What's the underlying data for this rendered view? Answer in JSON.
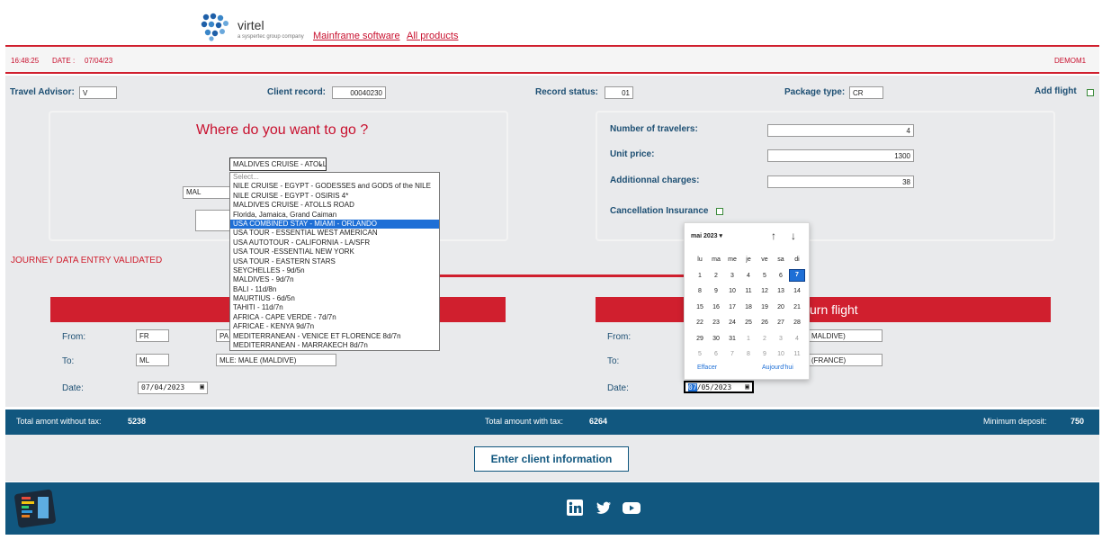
{
  "header": {
    "logo_text": "virtel",
    "logo_sub": "a syspertec group company",
    "links": [
      "Mainframe software",
      "All products"
    ]
  },
  "info": {
    "time": "16:48:25",
    "date_label": "DATE :",
    "date": "07/04/23",
    "user": "DEMOM1"
  },
  "form": {
    "travel_advisor_label": "Travel Advisor:",
    "travel_advisor": "V",
    "client_record_label": "Client record:",
    "client_record": "00040230",
    "record_status_label": "Record status:",
    "record_status": "01",
    "package_type_label": "Package type:",
    "package_type": "CR",
    "add_flight_label": "Add flight"
  },
  "destination": {
    "question": "Where do you want to go ?",
    "selected": "MALDIVES CRUISE - ATOLLS ROAD",
    "partial_field": "MAL",
    "options": [
      "Select...",
      "NILE CRUISE - EGYPT - GODESSES and GODS of the NILE",
      "NILE CRUISE - EGYPT - OSIRIS 4*",
      "MALDIVES CRUISE - ATOLLS ROAD",
      "Florida, Jamaica, Grand Caiman",
      "USA COMBINED STAY - MIAMI - ORLANDO",
      "USA TOUR - ESSENTIAL WEST AMERICAN",
      "USA AUTOTOUR - CALIFORNIA - LA/SFR",
      "USA TOUR -ESSENTIAL NEW YORK",
      "USA TOUR - EASTERN STARS",
      "SEYCHELLES - 9d/5n",
      "MALDIVES - 9d/7n",
      "BALI - 11d/8n",
      "MAURTIUS - 6d/5n",
      "TAHITI - 11d/7n",
      "AFRICA - CAPE VERDE - 7d/7n",
      "AFRICAE - KENYA 9d/7n",
      "MEDITERRANEAN - VENICE ET FLORENCE 8d/7n",
      "MEDITERRANEAN - MARRAKECH 8d/7n"
    ],
    "highlighted_index": 5
  },
  "pricing": {
    "travelers_label": "Number of travelers:",
    "travelers": "4",
    "unit_price_label": "Unit price:",
    "unit_price": "1300",
    "charges_label": "Additionnal charges:",
    "charges": "38",
    "cancellation_label": "Cancellation Insurance"
  },
  "status_message": "JOURNEY DATA ENTRY VALIDATED",
  "outbound": {
    "from_label": "From:",
    "from_code": "FR",
    "from_name": "PA",
    "to_label": "To:",
    "to_code": "ML",
    "to_name": "MLE: MALE (MALDIVE)",
    "date_label": "Date:",
    "date": "07/04/2023"
  },
  "return_flight": {
    "title_partial": "urn flight",
    "from_label": "From:",
    "from_name": "MALDIVE)",
    "to_label": "To:",
    "to_name": "(FRANCE)",
    "date_label": "Date:",
    "date_day": "07",
    "date_rest": "/05/2023"
  },
  "calendar": {
    "month": "mai 2023 ▾",
    "weekdays": [
      "lu",
      "ma",
      "me",
      "je",
      "ve",
      "sa",
      "di"
    ],
    "weeks": [
      [
        "1",
        "2",
        "3",
        "4",
        "5",
        "6",
        "7"
      ],
      [
        "8",
        "9",
        "10",
        "11",
        "12",
        "13",
        "14"
      ],
      [
        "15",
        "16",
        "17",
        "18",
        "19",
        "20",
        "21"
      ],
      [
        "22",
        "23",
        "24",
        "25",
        "26",
        "27",
        "28"
      ],
      [
        "29",
        "30",
        "31",
        "1",
        "2",
        "3",
        "4"
      ],
      [
        "5",
        "6",
        "7",
        "8",
        "9",
        "10",
        "11"
      ]
    ],
    "selected_day": "7",
    "clear_label": "Effacer",
    "today_label": "Aujourd'hui"
  },
  "totals": {
    "without_tax_label": "Total amont without tax:",
    "without_tax": "5238",
    "with_tax_label": "Total amount with tax:",
    "with_tax": "6264",
    "deposit_label": "Minimum deposit:",
    "deposit": "750"
  },
  "actions": {
    "enter_client": "Enter client information"
  },
  "colors": {
    "brand_red": "#d01f2e",
    "brand_blue": "#11577f",
    "select_blue": "#1e6fd6"
  }
}
